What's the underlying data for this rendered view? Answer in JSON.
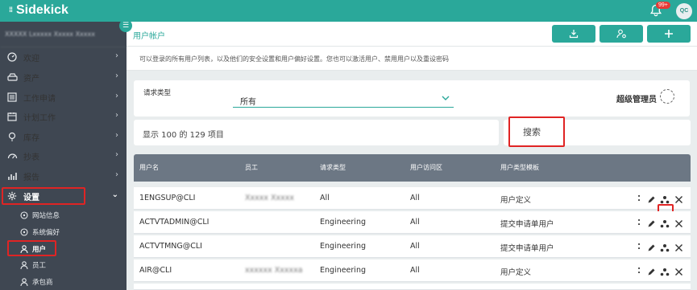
{
  "app": {
    "logo": "Sidekick",
    "notifications_badge": "99+",
    "user_initials": "QC"
  },
  "sidebar": {
    "org_name": "XXXXX Lxxxxx Xxxxx Xxxxx",
    "items": [
      {
        "label": "欢迎",
        "icon": "dashboard-icon"
      },
      {
        "label": "资产",
        "icon": "car-icon"
      },
      {
        "label": "工作申请",
        "icon": "list-icon"
      },
      {
        "label": "计划工作",
        "icon": "calendar-icon"
      },
      {
        "label": "库存",
        "icon": "lightbulb-icon"
      },
      {
        "label": "抄表",
        "icon": "gauge-icon"
      },
      {
        "label": "报告",
        "icon": "bar-chart-icon"
      },
      {
        "label": "设置",
        "icon": "gear-icon"
      }
    ],
    "sub_items": [
      {
        "label": "网站信息",
        "icon": "location-icon"
      },
      {
        "label": "系统偏好",
        "icon": "location-icon"
      },
      {
        "label": "用户",
        "icon": "user-icon"
      },
      {
        "label": "员工",
        "icon": "user-icon"
      },
      {
        "label": "承包商",
        "icon": "user-icon"
      }
    ]
  },
  "header": {
    "title": "用户帐户"
  },
  "description": "可以登录的所有用户列表，以及他们的安全设置和用户偏好设置。您也可以激活用户、禁用用户以及重设密码",
  "filter": {
    "label": "请求类型",
    "selected": "所有",
    "super_admin_label": "超级管理员"
  },
  "count_text": "显示 100 的 129 项目",
  "search": {
    "placeholder": "搜索"
  },
  "table": {
    "columns": [
      "用户名",
      "员工",
      "请求类型",
      "用户访问区",
      "用户类型模板"
    ],
    "rows": [
      {
        "username": "1ENGSUP@CLI",
        "employee": "Xxxxx Xxxxx",
        "request_type": "All",
        "access": "All",
        "template": "用户定义"
      },
      {
        "username": "ACTVTADMIN@CLI",
        "employee": "",
        "request_type": "Engineering",
        "access": "All",
        "template": "提交申请单用户"
      },
      {
        "username": "ACTVTMNG@CLI",
        "employee": "",
        "request_type": "Engineering",
        "access": "All",
        "template": "提交申请单用户"
      },
      {
        "username": "AIR@CLI",
        "employee": "xxxxxx Xxxxxa",
        "request_type": "Engineering",
        "access": "All",
        "template": "用户定义"
      }
    ]
  },
  "colors": {
    "accent": "#2aa89a",
    "sidebar_bg": "#3f4752",
    "table_header": "#6c7784",
    "highlight": "#e02424"
  }
}
